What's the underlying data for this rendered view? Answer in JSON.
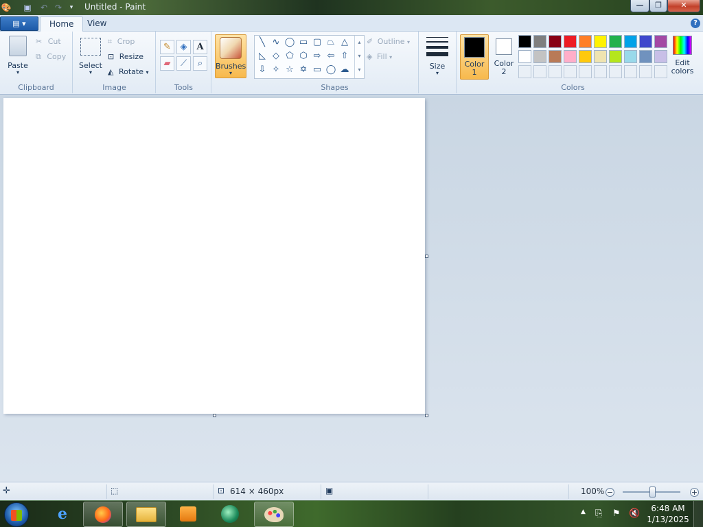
{
  "window": {
    "title": "Untitled - Paint",
    "controls": {
      "minimize": "—",
      "maximize": "❐",
      "close": "✕"
    }
  },
  "tabs": [
    {
      "label": "Home",
      "active": true
    },
    {
      "label": "View",
      "active": false
    }
  ],
  "ribbon": {
    "clipboard": {
      "label": "Clipboard",
      "paste": "Paste",
      "cut": "Cut",
      "copy": "Copy"
    },
    "image": {
      "label": "Image",
      "select": "Select",
      "crop": "Crop",
      "resize": "Resize",
      "rotate": "Rotate"
    },
    "tools": {
      "label": "Tools"
    },
    "brushes": {
      "label": "Brushes"
    },
    "shapes": {
      "label": "Shapes",
      "outline": "Outline",
      "fill": "Fill"
    },
    "size": {
      "label": "Size"
    },
    "colors": {
      "label": "Colors",
      "color1": "Color 1",
      "color1_line1": "Color",
      "color1_line2": "1",
      "color2_line1": "Color",
      "color2_line2": "2",
      "edit_colors_line1": "Edit",
      "edit_colors_line2": "colors",
      "color1_value": "#000000",
      "color2_value": "#ffffff",
      "palette_row1": [
        "#000000",
        "#7f7f7f",
        "#880015",
        "#ed1c24",
        "#ff7f27",
        "#fff200",
        "#22b14c",
        "#00a2e8",
        "#3f48cc",
        "#a349a4"
      ],
      "palette_row2": [
        "#ffffff",
        "#c3c3c3",
        "#b97a57",
        "#ffaec9",
        "#ffc90e",
        "#efe4b0",
        "#b5e61d",
        "#99d9ea",
        "#7092be",
        "#c8bfe7"
      ]
    }
  },
  "statusbar": {
    "dimensions": "614 × 460px",
    "zoom": "100%",
    "zoom_level": 1.0
  },
  "taskbar": {
    "time": "6:48 AM",
    "date": "1/13/2025",
    "apps": [
      "internet-explorer",
      "firefox",
      "file-explorer",
      "media-player",
      "media-center",
      "paint"
    ]
  }
}
